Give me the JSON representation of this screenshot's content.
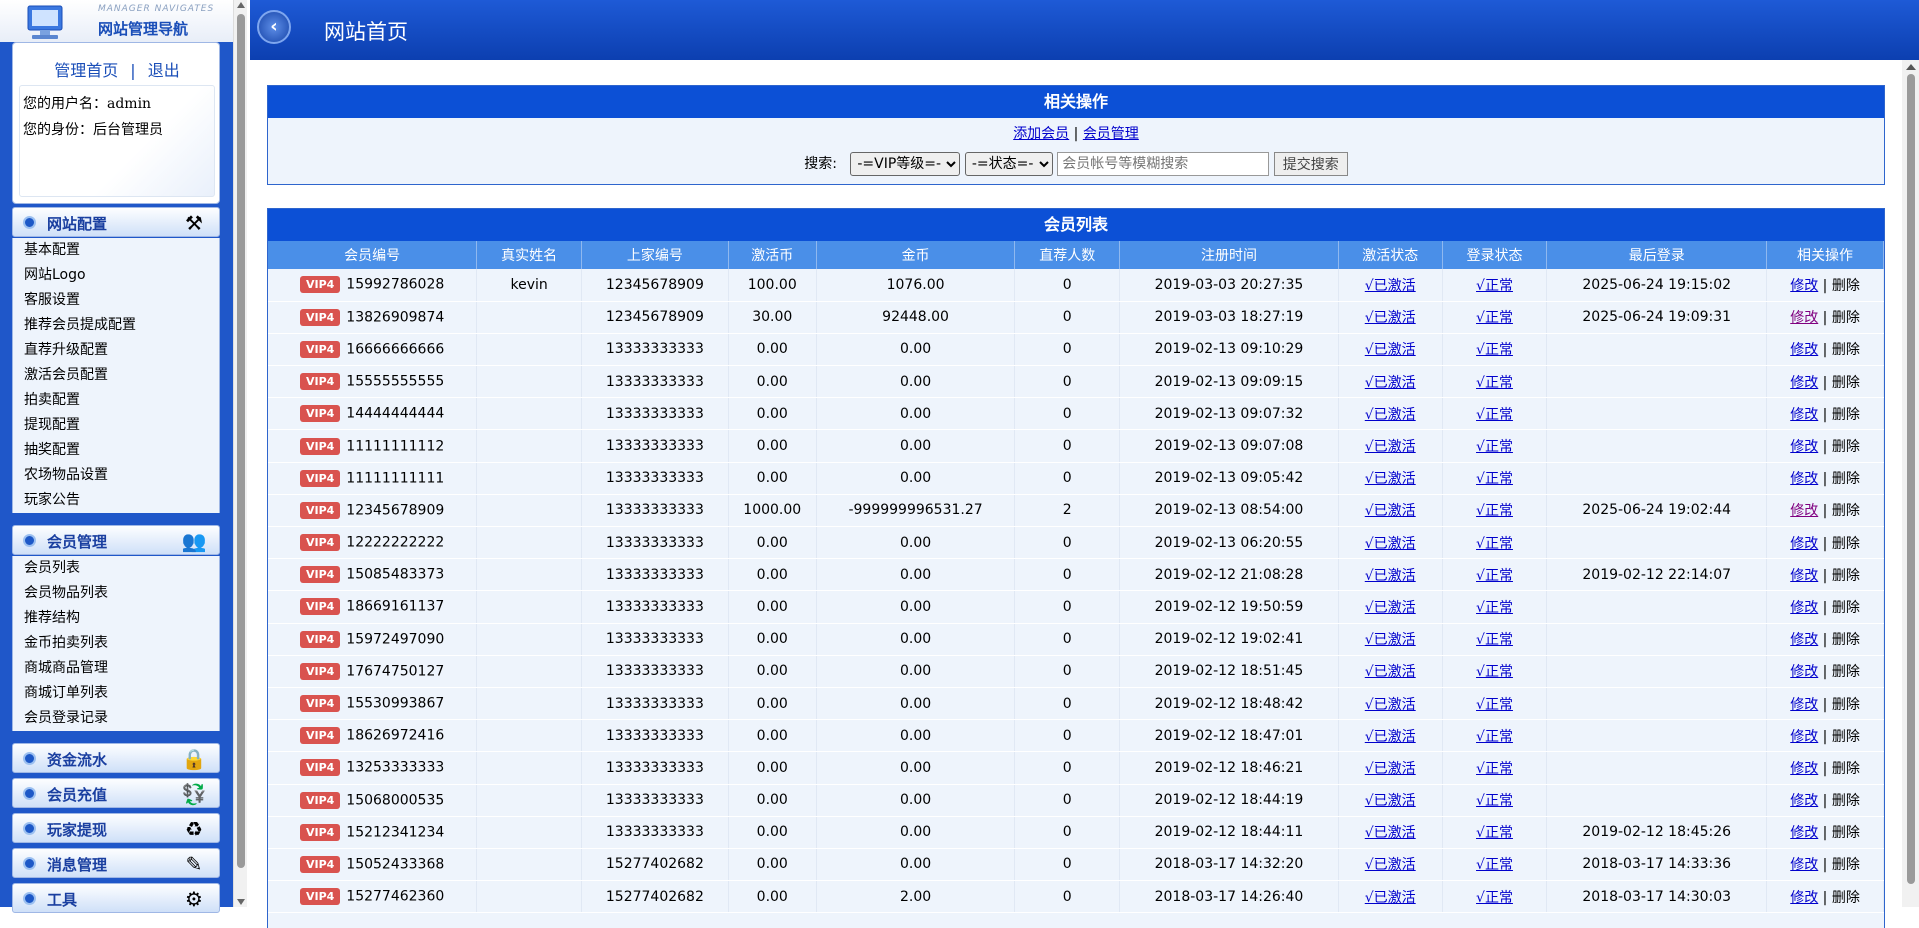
{
  "sidebar": {
    "brand_en": "MANAGER NAVIGATES",
    "brand_cn": "网站管理导航",
    "links": {
      "home": "管理首页",
      "sep": "|",
      "logout": "退出"
    },
    "username_line": "您的用户名：admin",
    "role_line": "您的身份：后台管理员",
    "menus": [
      {
        "title": "网站配置",
        "icon": "tools-icon",
        "items": [
          "基本配置",
          "网站Logo",
          "客服设置",
          "推荐会员提成配置",
          "直荐升级配置",
          "激活会员配置",
          "拍卖配置",
          "提现配置",
          "抽奖配置",
          "农场物品设置",
          "玩家公告"
        ]
      },
      {
        "title": "会员管理",
        "icon": "users-icon",
        "items": [
          "会员列表",
          "会员物品列表",
          "推荐结构",
          "金币拍卖列表",
          "商城商品管理",
          "商城订单列表",
          "会员登录记录"
        ]
      },
      {
        "title": "资金流水",
        "icon": "lock-icon",
        "items": []
      },
      {
        "title": "会员充值",
        "icon": "recharge-icon",
        "items": []
      },
      {
        "title": "玩家提现",
        "icon": "withdraw-icon",
        "items": []
      },
      {
        "title": "消息管理",
        "icon": "message-icon",
        "items": []
      },
      {
        "title": "工具",
        "icon": "tool-icon",
        "items": []
      }
    ]
  },
  "header": {
    "title": "网站首页"
  },
  "ops": {
    "title": "相关操作",
    "add_member": "添加会员",
    "sep": "|",
    "member_manage": "会员管理",
    "search_label": "搜索:",
    "vip_select": "-=VIP等级=-",
    "status_select": "-=状态=-",
    "search_placeholder": "会员帐号等模糊搜索",
    "submit": "提交搜索"
  },
  "list": {
    "title": "会员列表",
    "columns": [
      "会员编号",
      "真实姓名",
      "上家编号",
      "激活币",
      "金币",
      "直荐人数",
      "注册时间",
      "激活状态",
      "登录状态",
      "最后登录",
      "相关操作"
    ],
    "edit_label": "修改",
    "delete_label": "删除",
    "rows": [
      {
        "vip": "VIP4",
        "id": "15992786028",
        "name": "kevin",
        "parent": "12345678909",
        "act": "100.00",
        "gold": "1076.00",
        "refs": "0",
        "reg": "2019-03-03 20:27:35",
        "active": "√已激活",
        "login": "√正常",
        "last": "2025-06-24 19:15:02",
        "edit_visited": false
      },
      {
        "vip": "VIP4",
        "id": "13826909874",
        "name": "",
        "parent": "12345678909",
        "act": "30.00",
        "gold": "92448.00",
        "refs": "0",
        "reg": "2019-03-03 18:27:19",
        "active": "√已激活",
        "login": "√正常",
        "last": "2025-06-24 19:09:31",
        "edit_visited": true
      },
      {
        "vip": "VIP4",
        "id": "16666666666",
        "name": "",
        "parent": "13333333333",
        "act": "0.00",
        "gold": "0.00",
        "refs": "0",
        "reg": "2019-02-13 09:10:29",
        "active": "√已激活",
        "login": "√正常",
        "last": "",
        "edit_visited": false
      },
      {
        "vip": "VIP4",
        "id": "15555555555",
        "name": "",
        "parent": "13333333333",
        "act": "0.00",
        "gold": "0.00",
        "refs": "0",
        "reg": "2019-02-13 09:09:15",
        "active": "√已激活",
        "login": "√正常",
        "last": "",
        "edit_visited": false
      },
      {
        "vip": "VIP4",
        "id": "14444444444",
        "name": "",
        "parent": "13333333333",
        "act": "0.00",
        "gold": "0.00",
        "refs": "0",
        "reg": "2019-02-13 09:07:32",
        "active": "√已激活",
        "login": "√正常",
        "last": "",
        "edit_visited": false
      },
      {
        "vip": "VIP4",
        "id": "11111111112",
        "name": "",
        "parent": "13333333333",
        "act": "0.00",
        "gold": "0.00",
        "refs": "0",
        "reg": "2019-02-13 09:07:08",
        "active": "√已激活",
        "login": "√正常",
        "last": "",
        "edit_visited": false
      },
      {
        "vip": "VIP4",
        "id": "11111111111",
        "name": "",
        "parent": "13333333333",
        "act": "0.00",
        "gold": "0.00",
        "refs": "0",
        "reg": "2019-02-13 09:05:42",
        "active": "√已激活",
        "login": "√正常",
        "last": "",
        "edit_visited": false
      },
      {
        "vip": "VIP4",
        "id": "12345678909",
        "name": "",
        "parent": "13333333333",
        "act": "1000.00",
        "gold": "-999999996531.27",
        "refs": "2",
        "reg": "2019-02-13 08:54:00",
        "active": "√已激活",
        "login": "√正常",
        "last": "2025-06-24 19:02:44",
        "edit_visited": true
      },
      {
        "vip": "VIP4",
        "id": "12222222222",
        "name": "",
        "parent": "13333333333",
        "act": "0.00",
        "gold": "0.00",
        "refs": "0",
        "reg": "2019-02-13 06:20:55",
        "active": "√已激活",
        "login": "√正常",
        "last": "",
        "edit_visited": false
      },
      {
        "vip": "VIP4",
        "id": "15085483373",
        "name": "",
        "parent": "13333333333",
        "act": "0.00",
        "gold": "0.00",
        "refs": "0",
        "reg": "2019-02-12 21:08:28",
        "active": "√已激活",
        "login": "√正常",
        "last": "2019-02-12 22:14:07",
        "edit_visited": false
      },
      {
        "vip": "VIP4",
        "id": "18669161137",
        "name": "",
        "parent": "13333333333",
        "act": "0.00",
        "gold": "0.00",
        "refs": "0",
        "reg": "2019-02-12 19:50:59",
        "active": "√已激活",
        "login": "√正常",
        "last": "",
        "edit_visited": false
      },
      {
        "vip": "VIP4",
        "id": "15972497090",
        "name": "",
        "parent": "13333333333",
        "act": "0.00",
        "gold": "0.00",
        "refs": "0",
        "reg": "2019-02-12 19:02:41",
        "active": "√已激活",
        "login": "√正常",
        "last": "",
        "edit_visited": false
      },
      {
        "vip": "VIP4",
        "id": "17674750127",
        "name": "",
        "parent": "13333333333",
        "act": "0.00",
        "gold": "0.00",
        "refs": "0",
        "reg": "2019-02-12 18:51:45",
        "active": "√已激活",
        "login": "√正常",
        "last": "",
        "edit_visited": false
      },
      {
        "vip": "VIP4",
        "id": "15530993867",
        "name": "",
        "parent": "13333333333",
        "act": "0.00",
        "gold": "0.00",
        "refs": "0",
        "reg": "2019-02-12 18:48:42",
        "active": "√已激活",
        "login": "√正常",
        "last": "",
        "edit_visited": false
      },
      {
        "vip": "VIP4",
        "id": "18626972416",
        "name": "",
        "parent": "13333333333",
        "act": "0.00",
        "gold": "0.00",
        "refs": "0",
        "reg": "2019-02-12 18:47:01",
        "active": "√已激活",
        "login": "√正常",
        "last": "",
        "edit_visited": false
      },
      {
        "vip": "VIP4",
        "id": "13253333333",
        "name": "",
        "parent": "13333333333",
        "act": "0.00",
        "gold": "0.00",
        "refs": "0",
        "reg": "2019-02-12 18:46:21",
        "active": "√已激活",
        "login": "√正常",
        "last": "",
        "edit_visited": false
      },
      {
        "vip": "VIP4",
        "id": "15068000535",
        "name": "",
        "parent": "13333333333",
        "act": "0.00",
        "gold": "0.00",
        "refs": "0",
        "reg": "2019-02-12 18:44:19",
        "active": "√已激活",
        "login": "√正常",
        "last": "",
        "edit_visited": false
      },
      {
        "vip": "VIP4",
        "id": "15212341234",
        "name": "",
        "parent": "13333333333",
        "act": "0.00",
        "gold": "0.00",
        "refs": "0",
        "reg": "2019-02-12 18:44:11",
        "active": "√已激活",
        "login": "√正常",
        "last": "2019-02-12 18:45:26",
        "edit_visited": false
      },
      {
        "vip": "VIP4",
        "id": "15052433368",
        "name": "",
        "parent": "15277402682",
        "act": "0.00",
        "gold": "0.00",
        "refs": "0",
        "reg": "2018-03-17 14:32:20",
        "active": "√已激活",
        "login": "√正常",
        "last": "2018-03-17 14:33:36",
        "edit_visited": false
      },
      {
        "vip": "VIP4",
        "id": "15277462360",
        "name": "",
        "parent": "15277402682",
        "act": "0.00",
        "gold": "2.00",
        "refs": "0",
        "reg": "2018-03-17 14:26:40",
        "active": "√已激活",
        "login": "√正常",
        "last": "2018-03-17 14:30:03",
        "edit_visited": false
      }
    ]
  }
}
